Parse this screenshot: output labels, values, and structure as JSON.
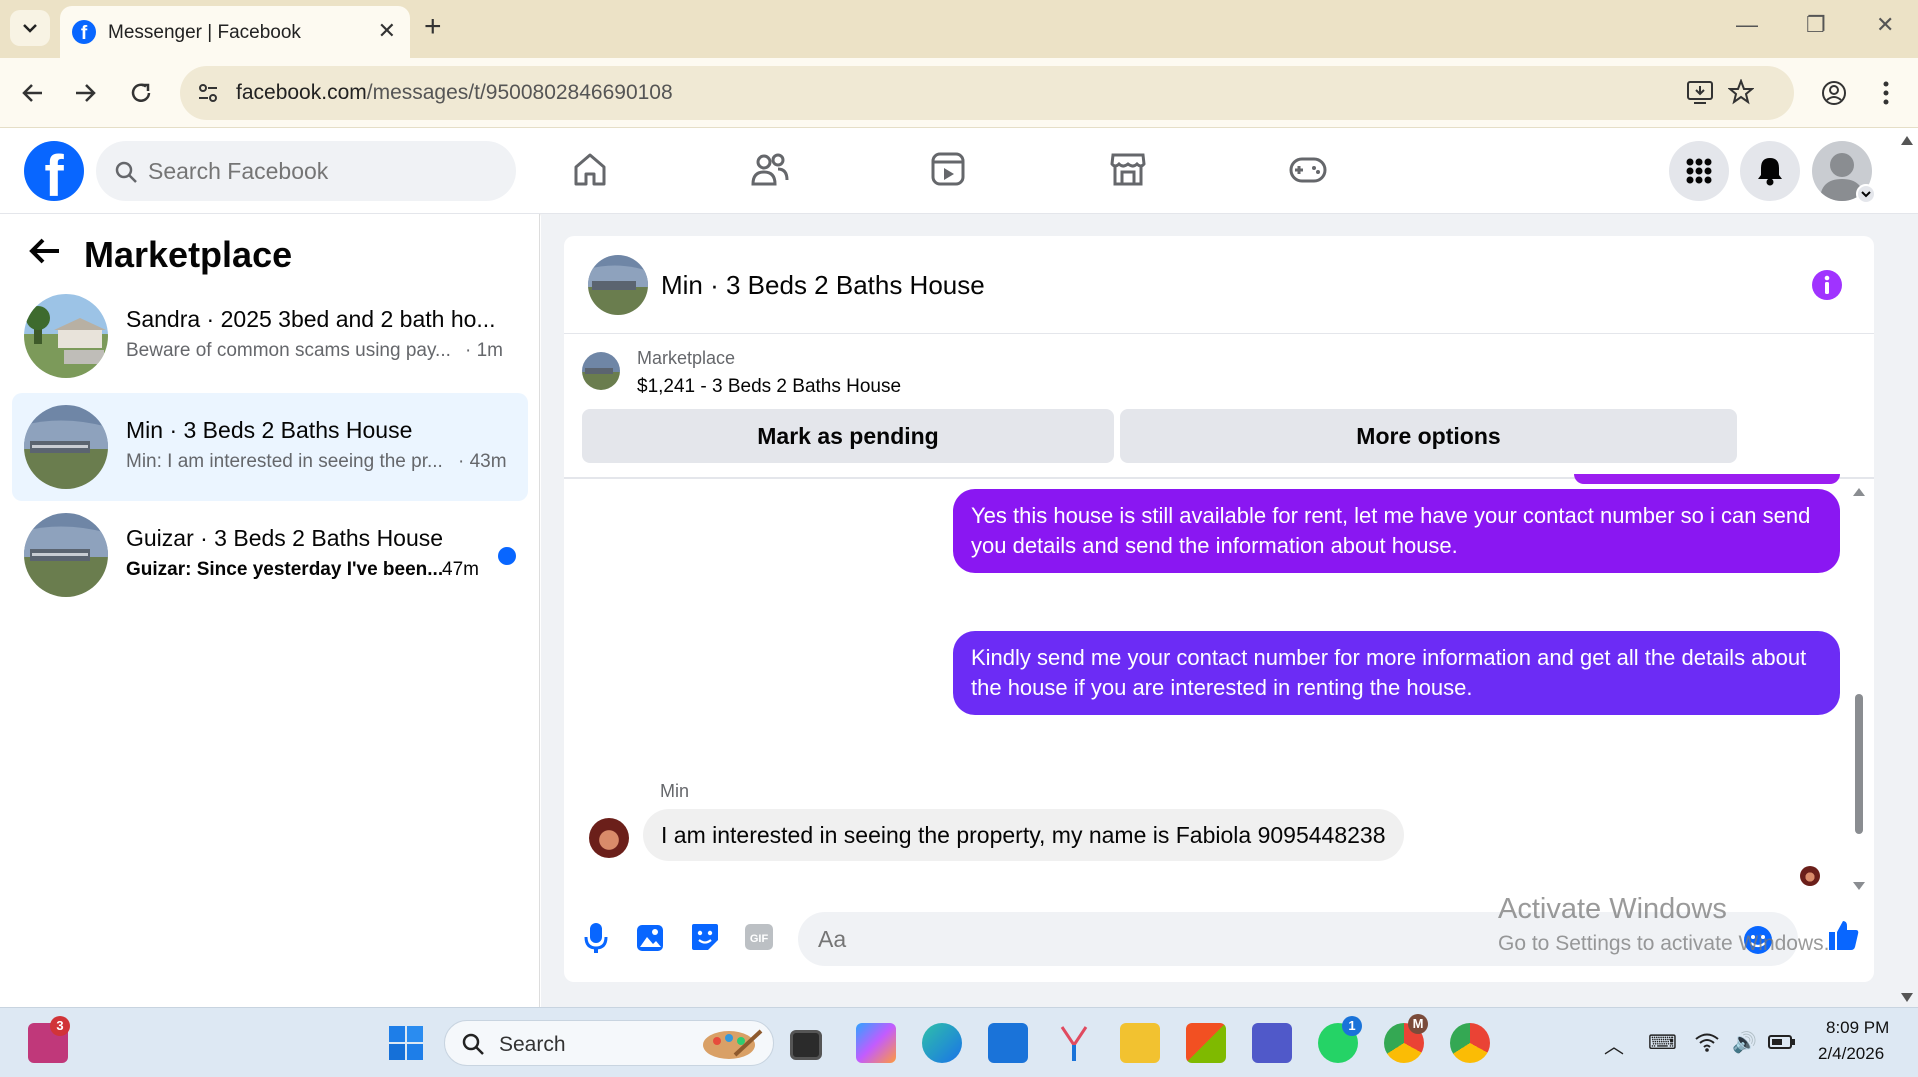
{
  "browser": {
    "tab_title": "Messenger | Facebook",
    "url_domain": "facebook.com",
    "url_path": "/messages/t/9500802846690108"
  },
  "header": {
    "search_placeholder": "Search Facebook",
    "nav_icons": [
      "home-icon",
      "friends-icon",
      "video-icon",
      "marketplace-icon",
      "gaming-icon"
    ],
    "brand_color": "#0866ff"
  },
  "sidebar": {
    "title": "Marketplace",
    "conversations": [
      {
        "name": "Sandra · 2025 3bed and 2 bath ho...",
        "preview": "Beware of common scams using pay...",
        "time": "· 1m",
        "unread": false,
        "active": false
      },
      {
        "name": "Min · 3 Beds 2 Baths House",
        "preview": "Min: I am interested in seeing the pr...",
        "time": "· 43m",
        "unread": false,
        "active": true
      },
      {
        "name": "Guizar · 3 Beds 2 Baths House",
        "preview": "Guizar: Since yesterday I've been...",
        "time": "47m",
        "unread": true,
        "active": false
      }
    ]
  },
  "chat": {
    "title": "Min · 3 Beds 2 Baths House",
    "listing_label": "Marketplace",
    "listing_price": "$1,241 - 3 Beds 2 Baths House",
    "mark_pending": "Mark as pending",
    "more_options": "More options",
    "messages": [
      {
        "direction": "out",
        "text": "Yes this house is still available for rent, let me have your contact number so i can send you details and send the information about house.",
        "color": "#8a17f2"
      },
      {
        "direction": "out",
        "text": "Kindly send me your contact number for more information and get all the details about the house if you are interested in renting the house.",
        "color": "#6c2cf5"
      },
      {
        "direction": "in",
        "sender": "Min",
        "text": "I am interested in seeing the property, my name is Fabiola 9095448238"
      }
    ],
    "composer_placeholder": "Aa",
    "accent_color": "#a033ff"
  },
  "watermark": {
    "line1": "Activate Windows",
    "line2": "Go to Settings to activate Windows."
  },
  "taskbar": {
    "search_label": "Search",
    "badges": {
      "notifications": "3",
      "whatsapp": "1",
      "chrome_profile": "M"
    },
    "time": "8:09 PM",
    "date": "2/4/2026"
  }
}
